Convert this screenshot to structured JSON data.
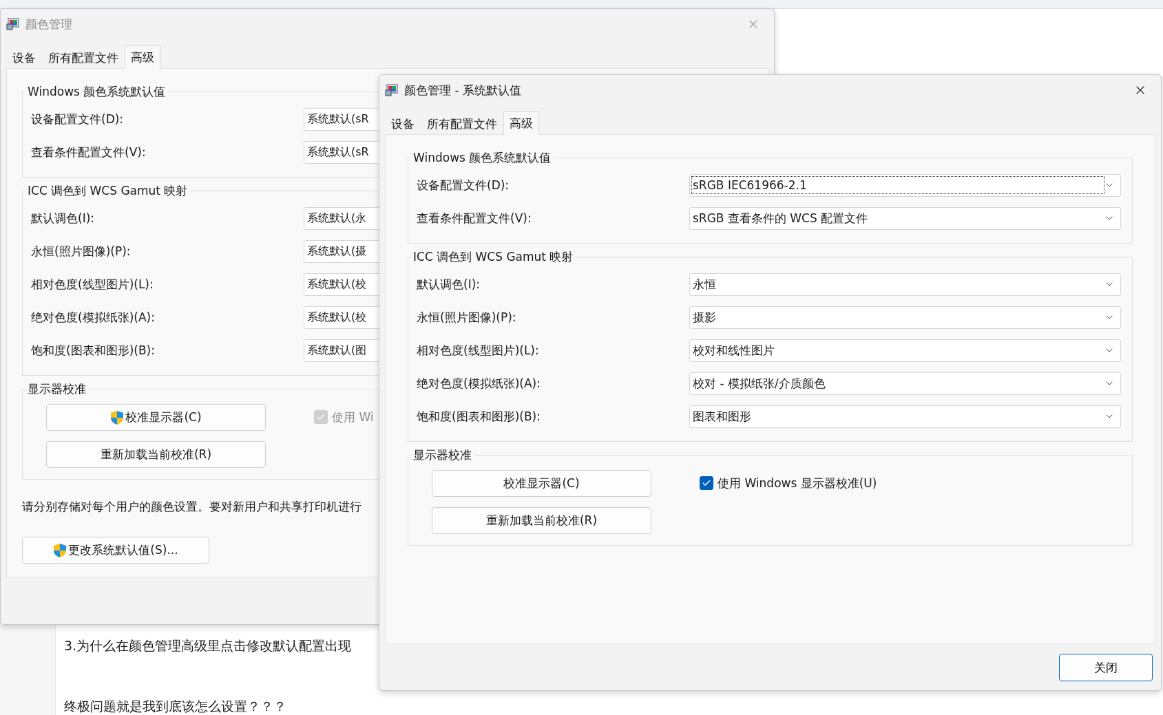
{
  "background_page": {
    "paragraphs": [
      "3.为什么在颜色管理高级里点击修改默认配置出现",
      "终极问题就是我到底该怎么设置？？？"
    ]
  },
  "windows": [
    {
      "kind": "inactive",
      "title": "颜色管理",
      "tabs": [
        {
          "label": "设备",
          "selected": false
        },
        {
          "label": "所有配置文件",
          "selected": false
        },
        {
          "label": "高级",
          "selected": true
        }
      ],
      "groups": [
        {
          "title": "Windows 颜色系统默认值",
          "rows": [
            {
              "label": "设备配置文件(D):",
              "value": "系统默认(sR"
            },
            {
              "label": "查看条件配置文件(V):",
              "value": "系统默认(sR"
            }
          ]
        },
        {
          "title": "ICC 调色到 WCS Gamut 映射",
          "rows": [
            {
              "label": "默认调色(I):",
              "value": "系统默认(永"
            },
            {
              "label": "永恒(照片图像)(P):",
              "value": "系统默认(摄"
            },
            {
              "label": "相对色度(线型图片)(L):",
              "value": "系统默认(校"
            },
            {
              "label": "绝对色度(模拟纸张)(A):",
              "value": "系统默认(校"
            },
            {
              "label": "饱和度(图表和图形)(B):",
              "value": "系统默认(图"
            }
          ]
        }
      ],
      "calibration": {
        "title": "显示器校准",
        "buttons": [
          {
            "label": "校准显示器(C)",
            "shield": true
          },
          {
            "label": "重新加载当前校准(R)",
            "shield": false
          }
        ],
        "checkbox": {
          "label": "使用 Wi",
          "checked": true,
          "disabled": true
        }
      },
      "note": "请分别存储对每个用户的颜色设置。要对新用户和共享打印机进行",
      "change_button": {
        "label": "更改系统默认值(S)...",
        "shield": true
      }
    },
    {
      "kind": "active",
      "title": "颜色管理 - 系统默认值",
      "tabs": [
        {
          "label": "设备",
          "selected": false
        },
        {
          "label": "所有配置文件",
          "selected": false
        },
        {
          "label": "高级",
          "selected": true
        }
      ],
      "groups": [
        {
          "title": "Windows 颜色系统默认值",
          "rows": [
            {
              "label": "设备配置文件(D):",
              "value": "sRGB IEC61966-2.1",
              "focused": true
            },
            {
              "label": "查看条件配置文件(V):",
              "value": "sRGB 查看条件的 WCS 配置文件",
              "focused": false
            }
          ]
        },
        {
          "title": "ICC 调色到 WCS Gamut 映射",
          "rows": [
            {
              "label": "默认调色(I):",
              "value": "永恒",
              "focused": false
            },
            {
              "label": "永恒(照片图像)(P):",
              "value": "摄影",
              "focused": false
            },
            {
              "label": "相对色度(线型图片)(L):",
              "value": "校对和线性图片",
              "focused": false
            },
            {
              "label": "绝对色度(模拟纸张)(A):",
              "value": "校对 - 模拟纸张/介质颜色",
              "focused": false
            },
            {
              "label": "饱和度(图表和图形)(B):",
              "value": "图表和图形",
              "focused": false
            }
          ]
        }
      ],
      "calibration": {
        "title": "显示器校准",
        "buttons": [
          {
            "label": "校准显示器(C)",
            "shield": false
          },
          {
            "label": "重新加载当前校准(R)",
            "shield": false
          }
        ],
        "checkbox": {
          "label": "使用 Windows 显示器校准(U)",
          "checked": true,
          "disabled": false
        }
      },
      "close_button": {
        "label": "关闭"
      }
    }
  ]
}
